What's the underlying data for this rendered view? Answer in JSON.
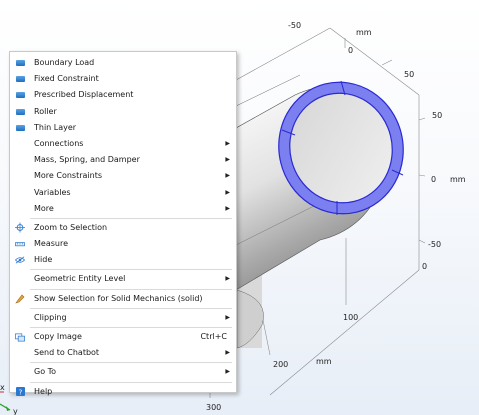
{
  "units": "mm",
  "axes": {
    "x_ticks": [
      "100",
      "200",
      "300"
    ],
    "y_ticks": [
      "-50",
      "0",
      "50"
    ],
    "z_ticks": [
      "50",
      "0",
      "-50"
    ],
    "side_tick": "0",
    "x_unit": "mm",
    "y_unit": "mm",
    "z_unit": "mm"
  },
  "triad": {
    "x": "x",
    "y": "y"
  },
  "colors": {
    "selection": "#7b7ff0",
    "menu_icon": "#2a78cf"
  },
  "context_menu": {
    "items": [
      {
        "label": "Boundary Load",
        "icon": "boundary-load-icon"
      },
      {
        "label": "Fixed Constraint",
        "icon": "fixed-constraint-icon"
      },
      {
        "label": "Prescribed Displacement",
        "icon": "prescribed-displacement-icon"
      },
      {
        "label": "Roller",
        "icon": "roller-icon"
      },
      {
        "label": "Thin Layer",
        "icon": "thin-layer-icon"
      },
      {
        "label": "Connections",
        "submenu": true
      },
      {
        "label": "Mass, Spring, and Damper",
        "submenu": true
      },
      {
        "label": "More Constraints",
        "submenu": true
      },
      {
        "label": "Variables",
        "submenu": true
      },
      {
        "label": "More",
        "submenu": true
      },
      {
        "label": "Zoom to Selection",
        "icon": "zoom-to-selection-icon"
      },
      {
        "label": "Measure",
        "icon": "measure-icon"
      },
      {
        "label": "Hide",
        "icon": "hide-icon"
      },
      {
        "label": "Geometric Entity Level",
        "submenu": true
      },
      {
        "label": "Show Selection for Solid Mechanics (solid)",
        "icon": "show-selection-icon"
      },
      {
        "label": "Clipping",
        "submenu": true
      },
      {
        "label": "Copy Image",
        "icon": "copy-image-icon",
        "shortcut": "Ctrl+C"
      },
      {
        "label": "Send to Chatbot",
        "submenu": true
      },
      {
        "label": "Go To",
        "submenu": true
      },
      {
        "label": "Help",
        "icon": "help-icon"
      }
    ]
  }
}
